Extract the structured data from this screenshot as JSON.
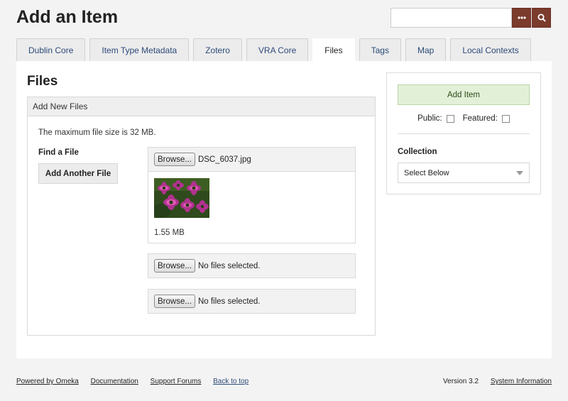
{
  "header": {
    "title": "Add an Item"
  },
  "search": {
    "placeholder": "",
    "options_icon": "ellipsis-icon",
    "submit_icon": "search-icon",
    "accent": "#7b3b2d"
  },
  "tabs": [
    {
      "label": "Dublin Core",
      "active": false
    },
    {
      "label": "Item Type Metadata",
      "active": false
    },
    {
      "label": "Zotero",
      "active": false
    },
    {
      "label": "VRA Core",
      "active": false
    },
    {
      "label": "Files",
      "active": true
    },
    {
      "label": "Tags",
      "active": false
    },
    {
      "label": "Map",
      "active": false
    },
    {
      "label": "Local Contexts",
      "active": false
    }
  ],
  "files": {
    "section_title": "Files",
    "legend": "Add New Files",
    "max_size_text": "The maximum file size is 32 MB.",
    "find_label": "Find a File",
    "add_another_label": "Add Another File",
    "inputs": [
      {
        "button": "Browse...",
        "filename": "DSC_6037.jpg",
        "preview_size": "1.55 MB"
      },
      {
        "button": "Browse...",
        "filename": "No files selected."
      },
      {
        "button": "Browse...",
        "filename": "No files selected."
      }
    ]
  },
  "sidebar": {
    "add_item_label": "Add Item",
    "public_label": "Public:",
    "featured_label": "Featured:",
    "collection_label": "Collection",
    "collection_select_value": "Select Below"
  },
  "footer": {
    "links": [
      "Powered by Omeka",
      "Documentation",
      "Support Forums",
      "Back to top"
    ],
    "version": "Version 3.2",
    "system_info": "System Information"
  }
}
